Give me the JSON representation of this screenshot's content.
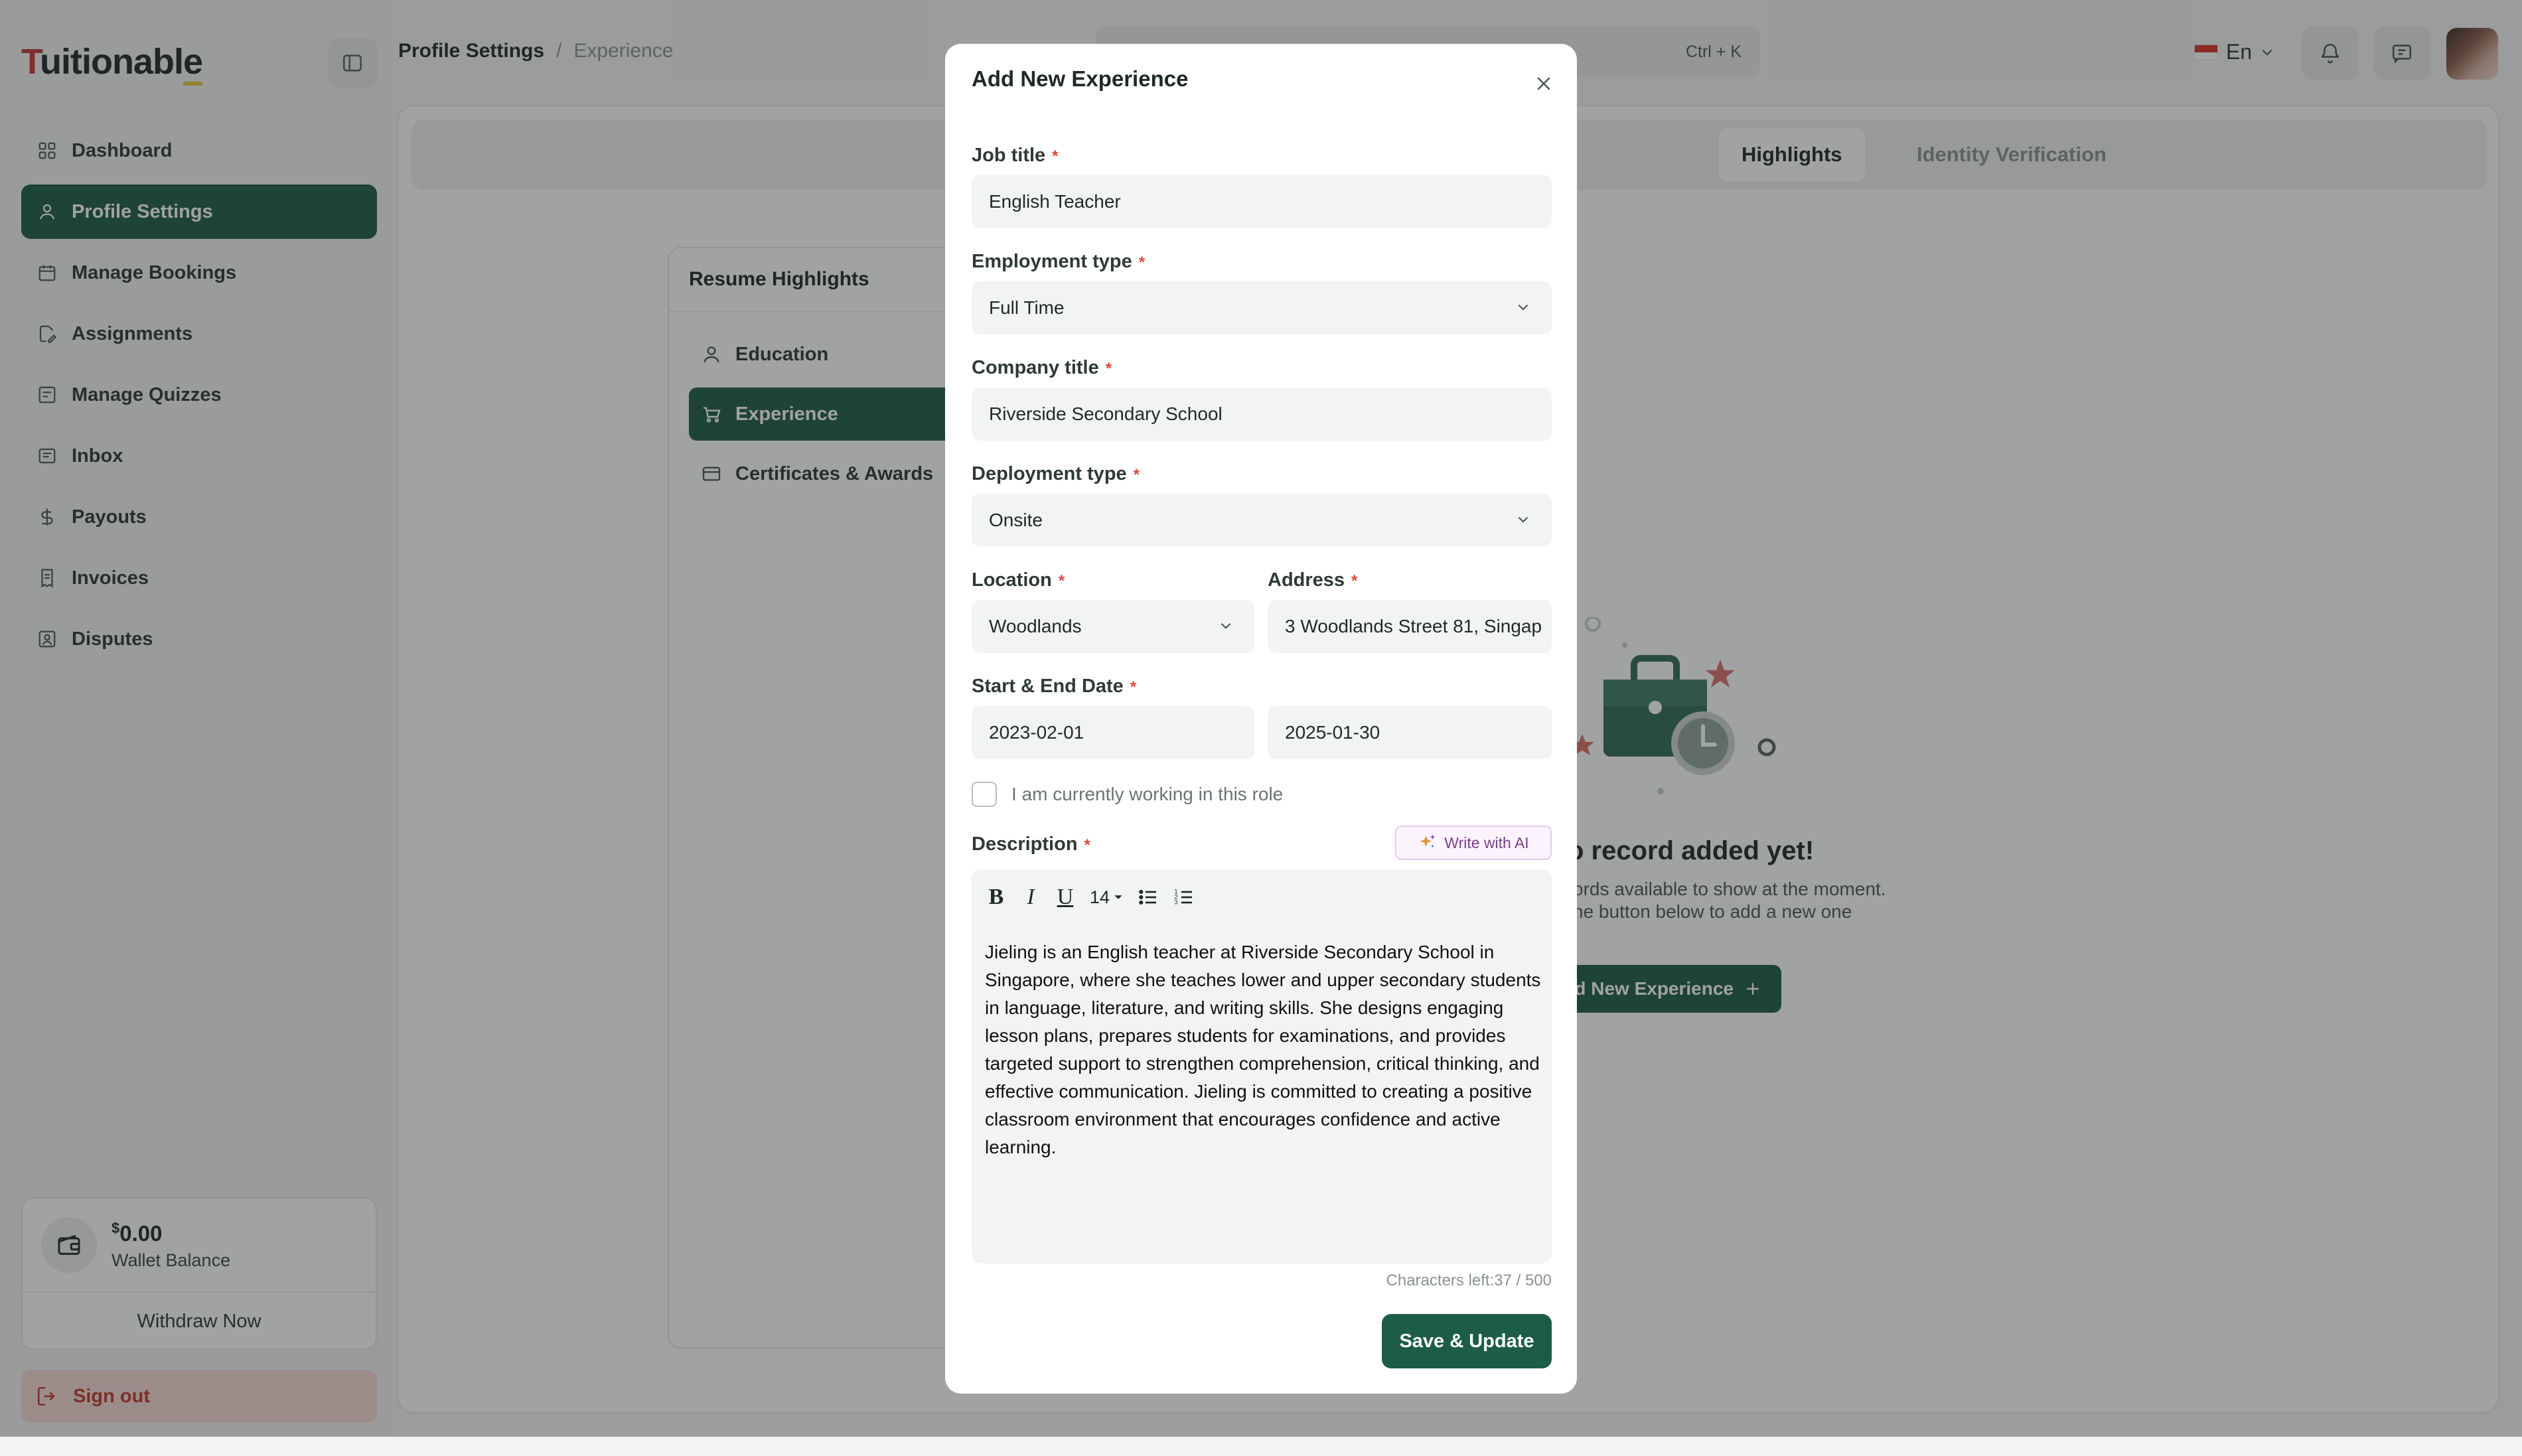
{
  "app": {
    "logo": "Tuitionable"
  },
  "sidebar": {
    "items": [
      {
        "label": "Dashboard",
        "icon": "grid-icon"
      },
      {
        "label": "Profile Settings",
        "icon": "user-icon"
      },
      {
        "label": "Manage Bookings",
        "icon": "calendar-icon"
      },
      {
        "label": "Assignments",
        "icon": "file-edit-icon"
      },
      {
        "label": "Manage Quizzes",
        "icon": "quiz-icon"
      },
      {
        "label": "Inbox",
        "icon": "inbox-icon"
      },
      {
        "label": "Payouts",
        "icon": "dollar-icon"
      },
      {
        "label": "Invoices",
        "icon": "invoice-icon"
      },
      {
        "label": "Disputes",
        "icon": "dispute-icon"
      }
    ],
    "active_index": 1,
    "wallet": {
      "currency": "$",
      "amount": "0.00",
      "label": "Wallet Balance",
      "withdraw_label": "Withdraw Now"
    },
    "signout_label": "Sign out"
  },
  "header": {
    "breadcrumb_main": "Profile Settings",
    "breadcrumb_sep": "/",
    "breadcrumb_sub": "Experience",
    "search_shortcut": "Ctrl + K",
    "language": "En"
  },
  "main": {
    "tabs": [
      {
        "label": "Highlights",
        "active": true
      },
      {
        "label": "Identity Verification",
        "active": false
      }
    ],
    "resume": {
      "title": "Resume Highlights",
      "items": [
        {
          "label": "Education"
        },
        {
          "label": "Experience"
        },
        {
          "label": "Certificates & Awards"
        }
      ]
    },
    "empty": {
      "title": "o record added yet!",
      "line1": "ords available to show at the moment.",
      "line2": "he button below to add a new one",
      "button": "Add New Experience"
    }
  },
  "modal": {
    "title": "Add New Experience",
    "job_title": {
      "label": "Job title",
      "value": "English Teacher"
    },
    "employment_type": {
      "label": "Employment type",
      "value": "Full Time"
    },
    "company_title": {
      "label": "Company title",
      "value": "Riverside Secondary School"
    },
    "deployment_type": {
      "label": "Deployment type",
      "value": "Onsite"
    },
    "location": {
      "label": "Location",
      "value": "Woodlands"
    },
    "address": {
      "label": "Address",
      "value": "3 Woodlands Street 81, Singap"
    },
    "dates": {
      "label": "Start & End Date",
      "start": "2023-02-01",
      "end": "2025-01-30"
    },
    "currently_working": "I am currently working in this role",
    "description": {
      "label": "Description",
      "ai_button": "Write with AI",
      "font_size": "14",
      "text": "Jieling is an English teacher at Riverside Secondary School in Singapore, where she teaches lower and upper secondary students in language, literature, and writing skills. She designs engaging lesson plans, prepares students for examinations, and provides targeted support to strengthen comprehension, critical thinking, and effective communication. Jieling is committed to creating a positive classroom environment that encourages confidence and active learning."
    },
    "char_count": "Characters left:37 / 500",
    "save_label": "Save & Update"
  },
  "colors": {
    "brand": "#1e5c4a",
    "required": "#e0473d",
    "danger": "#c0392b"
  }
}
